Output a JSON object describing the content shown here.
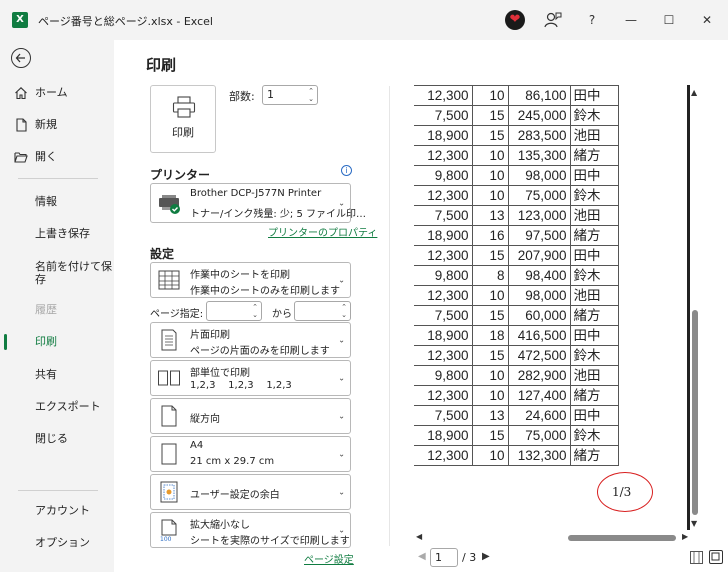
{
  "window": {
    "app_icon_letter": "X",
    "title": "ページ番号と総ページ.xlsx  -  Excel",
    "help": "?",
    "minimize": "—",
    "maximize": "☐",
    "close": "✕"
  },
  "nav": {
    "items": [
      {
        "label": "ホーム",
        "icon": "home-icon"
      },
      {
        "label": "新規",
        "icon": "new-file-icon"
      },
      {
        "label": "開く",
        "icon": "folder-open-icon"
      },
      {
        "label": "情報"
      },
      {
        "label": "上書き保存"
      },
      {
        "label": "名前を付けて保\n存"
      },
      {
        "label": "履歴"
      },
      {
        "label": "印刷"
      },
      {
        "label": "共有"
      },
      {
        "label": "エクスポート"
      },
      {
        "label": "閉じる"
      },
      {
        "label": "アカウント"
      },
      {
        "label": "オプション"
      }
    ]
  },
  "print": {
    "title": "印刷",
    "print_button": "印刷",
    "copies_label": "部数:",
    "copies_value": "1",
    "printer_section": "プリンター",
    "printer_name": "Brother DCP-J577N Printer",
    "printer_status": "トナー/インク残量: 少; 5 ファイル印…",
    "printer_properties": "プリンターのプロパティ",
    "settings_section": "設定",
    "what_l1": "作業中のシートを印刷",
    "what_l2": "作業中のシートのみを印刷します",
    "pages_label": "ページ指定:",
    "pages_to": "から",
    "pages_from_value": "",
    "pages_to_value": "",
    "sides_l1": "片面印刷",
    "sides_l2": "ページの片面のみを印刷します",
    "collate_l1": "部単位で印刷",
    "collate_l2": "1,2,3    1,2,3    1,2,3",
    "orientation_l1": "縦方向",
    "paper_l1": "A4",
    "paper_l2": "21 cm x 29.7 cm",
    "margins_l1": "ユーザー設定の余白",
    "scaling_l1": "拡大縮小なし",
    "scaling_l2": "シートを実際のサイズで印刷します",
    "scaling_icon_text": "100",
    "page_setup_link": "ページ設定"
  },
  "preview": {
    "rows": [
      [
        "12,300",
        "10",
        "86,100",
        "田中"
      ],
      [
        "7,500",
        "15",
        "245,000",
        "鈴木"
      ],
      [
        "18,900",
        "15",
        "283,500",
        "池田"
      ],
      [
        "12,300",
        "10",
        "135,300",
        "緒方"
      ],
      [
        "9,800",
        "10",
        "98,000",
        "田中"
      ],
      [
        "12,300",
        "10",
        "75,000",
        "鈴木"
      ],
      [
        "7,500",
        "13",
        "123,000",
        "池田"
      ],
      [
        "18,900",
        "16",
        "97,500",
        "緒方"
      ],
      [
        "12,300",
        "15",
        "207,900",
        "田中"
      ],
      [
        "9,800",
        "8",
        "98,400",
        "鈴木"
      ],
      [
        "12,300",
        "10",
        "98,000",
        "池田"
      ],
      [
        "7,500",
        "15",
        "60,000",
        "緒方"
      ],
      [
        "18,900",
        "18",
        "416,500",
        "田中"
      ],
      [
        "12,300",
        "15",
        "472,500",
        "鈴木"
      ],
      [
        "9,800",
        "10",
        "282,900",
        "池田"
      ],
      [
        "12,300",
        "10",
        "127,400",
        "緒方"
      ],
      [
        "7,500",
        "13",
        "24,600",
        "田中"
      ],
      [
        "18,900",
        "15",
        "75,000",
        "鈴木"
      ],
      [
        "12,300",
        "10",
        "132,300",
        "緒方"
      ]
    ],
    "page_number_text": "1/3",
    "current_page": "1",
    "total_pages": "/ 3"
  },
  "colors": {
    "accent": "#107c41",
    "annotation": "#d82020"
  }
}
